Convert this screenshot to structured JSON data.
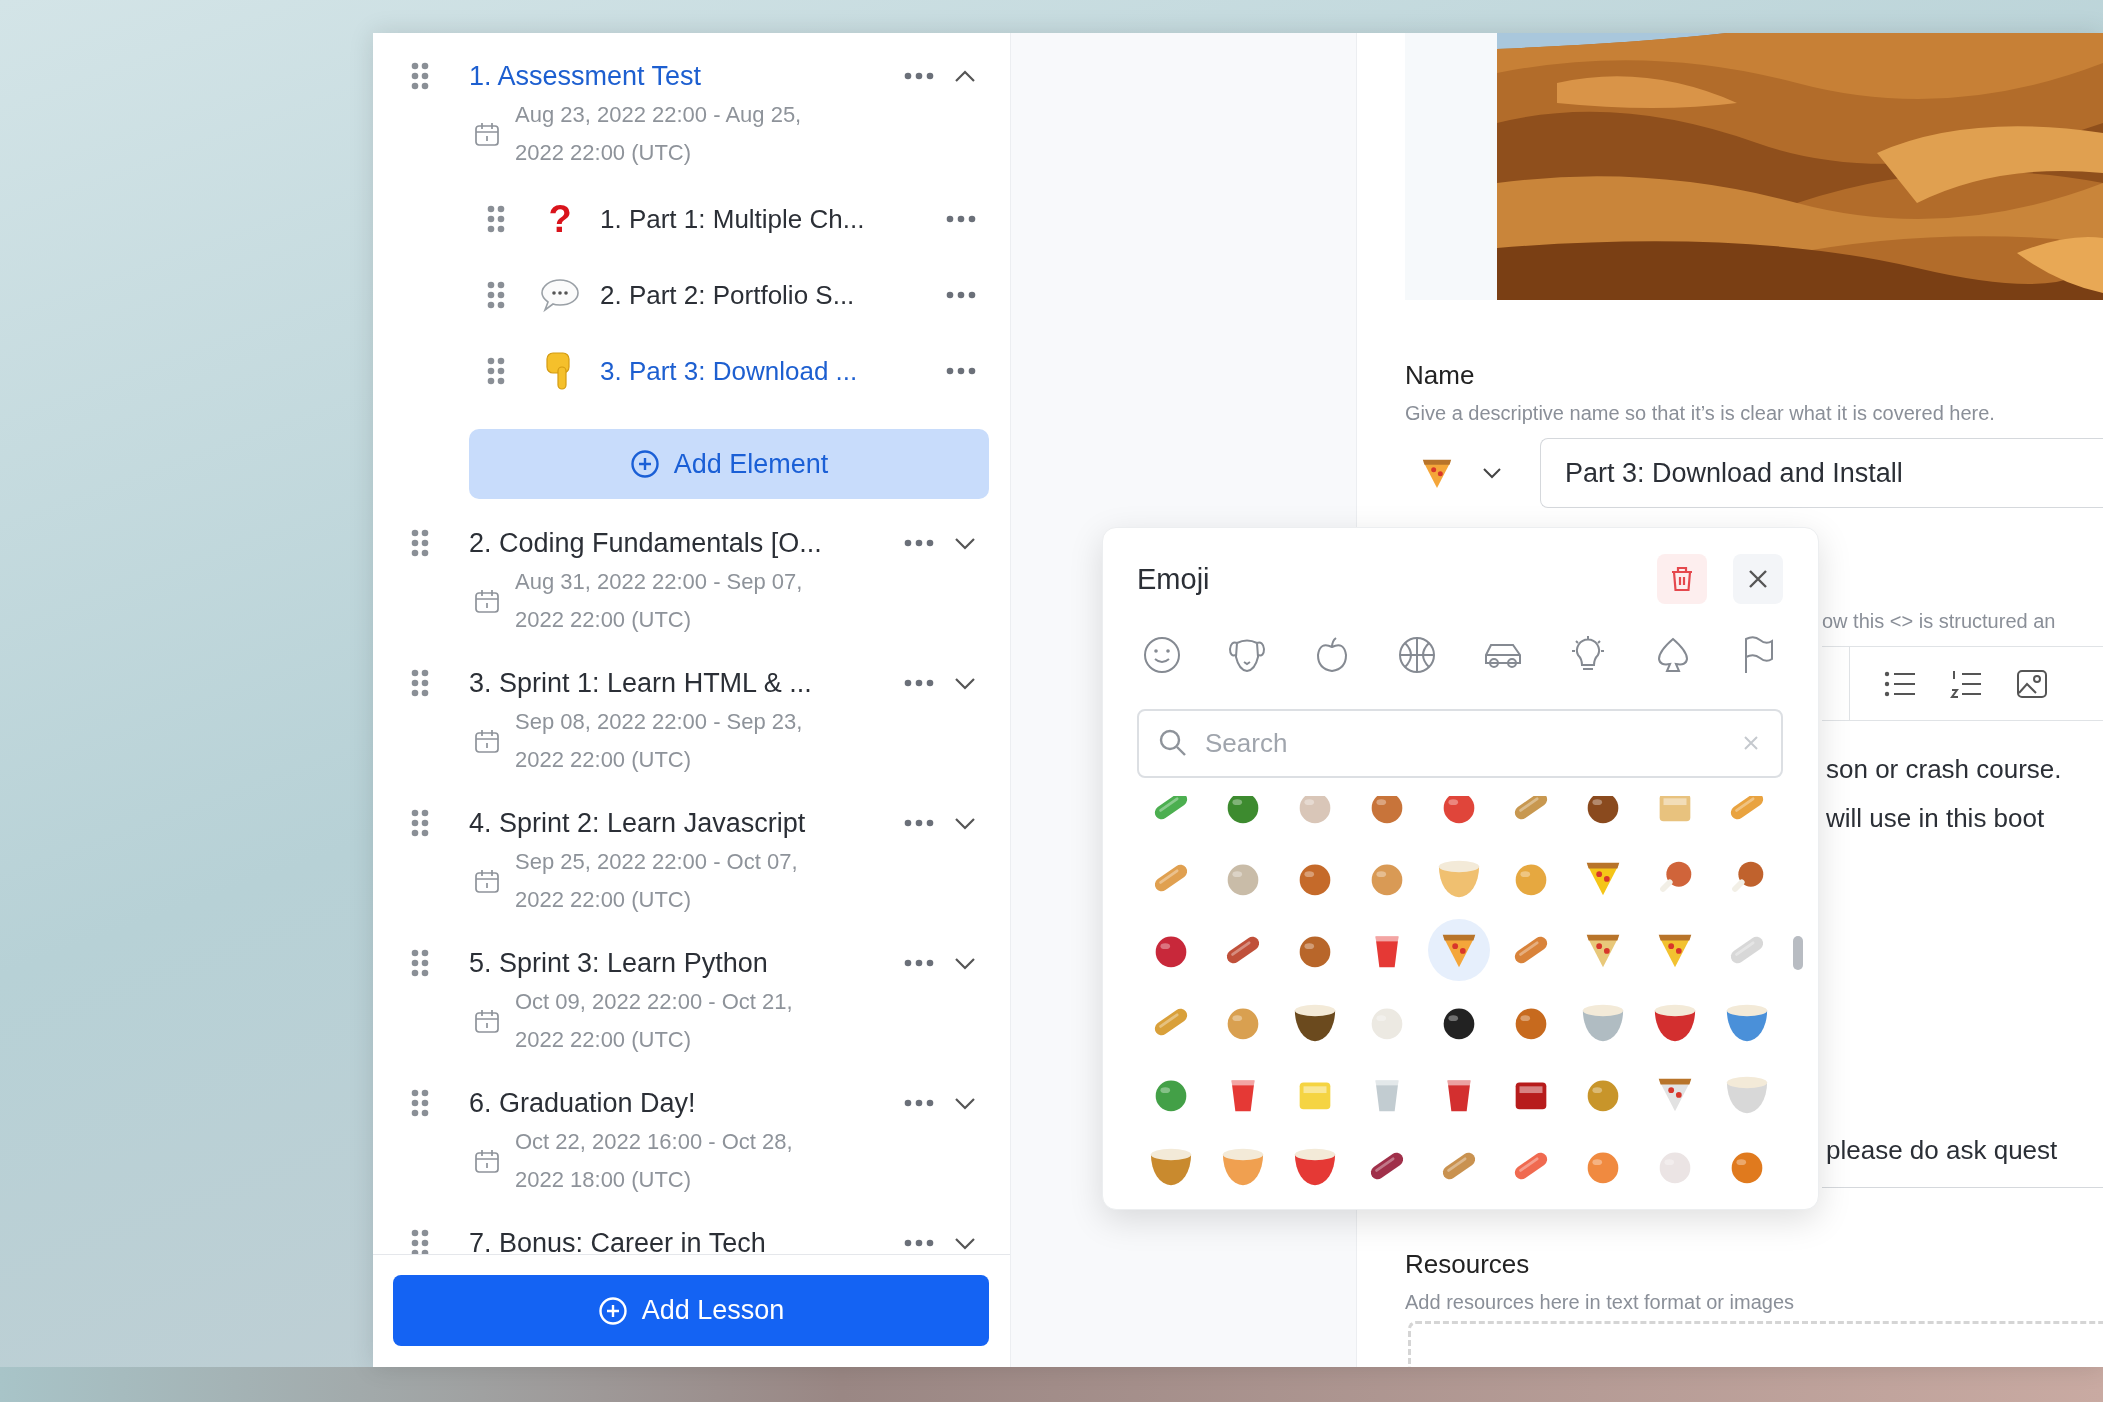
{
  "sidebar": {
    "lessons": [
      {
        "title": "1. Assessment Test",
        "selected": true,
        "expanded": true,
        "dates": "Aug 23, 2022 22:00 - Aug 25, 2022 22:00 (UTC)",
        "children": [
          {
            "kind": "glyph",
            "icon": "?",
            "title": "1. Part 1: Multiple Ch...",
            "selected": false
          },
          {
            "kind": "speech",
            "title": "2. Part 2: Portfolio S...",
            "selected": false
          },
          {
            "kind": "pointer",
            "title": "3. Part 3: Download ...",
            "selected": true
          }
        ],
        "add_button": "Add Element"
      },
      {
        "title": "2. Coding Fundamentals [O...",
        "selected": false,
        "expanded": false,
        "dates": "Aug 31, 2022 22:00 - Sep 07, 2022 22:00 (UTC)"
      },
      {
        "title": "3. Sprint 1: Learn HTML & ...",
        "selected": false,
        "expanded": false,
        "dates": "Sep 08, 2022 22:00 - Sep 23, 2022 22:00 (UTC)"
      },
      {
        "title": "4. Sprint 2: Learn Javascript",
        "selected": false,
        "expanded": false,
        "dates": "Sep 25, 2022 22:00 - Oct 07, 2022 22:00 (UTC)"
      },
      {
        "title": "5. Sprint 3: Learn Python",
        "selected": false,
        "expanded": false,
        "dates": "Oct 09, 2022 22:00 - Oct 21, 2022 22:00 (UTC)"
      },
      {
        "title": "6. Graduation Day!",
        "selected": false,
        "expanded": false,
        "dates": "Oct 22, 2022 16:00 - Oct 28, 2022 18:00 (UTC)"
      },
      {
        "title": "7. Bonus: Career in Tech",
        "selected": false,
        "expanded": false
      }
    ],
    "add_lesson": "Add Lesson"
  },
  "editor": {
    "name_label": "Name",
    "name_hint": "Give a descriptive name so that it’s is clear what it is covered here.",
    "name_value": "Part 3: Download and Install",
    "description_hint": "ow this <> is structured an",
    "content_lines": [
      "son or crash course.",
      "will use in this boot",
      "please do ask quest"
    ],
    "resources_label": "Resources",
    "resources_hint": "Add resources here in text format or images"
  },
  "emoji_picker": {
    "title": "Emoji",
    "search_placeholder": "Search",
    "items": [
      {
        "kind": "long",
        "color": "#4caf50",
        "selected": false
      },
      {
        "kind": "round",
        "color": "#3d8b2f",
        "selected": false
      },
      {
        "kind": "round",
        "color": "#d9c6b8",
        "selected": false
      },
      {
        "kind": "round",
        "color": "#c8743a",
        "selected": false
      },
      {
        "kind": "round",
        "color": "#e0453a",
        "selected": false
      },
      {
        "kind": "long",
        "color": "#c89850",
        "selected": false
      },
      {
        "kind": "round",
        "color": "#8a4a1e",
        "selected": false
      },
      {
        "kind": "box",
        "color": "#e8c27e",
        "selected": false
      },
      {
        "kind": "long",
        "color": "#e9a340",
        "selected": false
      },
      {
        "kind": "long",
        "color": "#e0a050",
        "selected": false
      },
      {
        "kind": "round",
        "color": "#c9bca8",
        "selected": false
      },
      {
        "kind": "round",
        "color": "#c56a2a",
        "selected": false
      },
      {
        "kind": "round",
        "color": "#d99a55",
        "selected": false
      },
      {
        "kind": "bowl",
        "color": "#f0c070",
        "selected": false
      },
      {
        "kind": "round",
        "color": "#e6a840",
        "selected": false
      },
      {
        "kind": "slice",
        "color": "#f5c518",
        "selected": false
      },
      {
        "kind": "drumstick",
        "color": "#d0643a",
        "selected": false
      },
      {
        "kind": "drumstick",
        "color": "#c0622d",
        "selected": false
      },
      {
        "kind": "round",
        "color": "#c8283a",
        "selected": false
      },
      {
        "kind": "long",
        "color": "#c0503a",
        "selected": false
      },
      {
        "kind": "round",
        "color": "#b8662a",
        "selected": false
      },
      {
        "kind": "cup",
        "color": "#e53935",
        "selected": false
      },
      {
        "kind": "slice",
        "color": "#f4a63a",
        "selected": true
      },
      {
        "kind": "long",
        "color": "#d9833a",
        "selected": false
      },
      {
        "kind": "slice",
        "color": "#e8c87a",
        "selected": false
      },
      {
        "kind": "slice",
        "color": "#f2c230",
        "selected": false
      },
      {
        "kind": "long",
        "color": "#d8d8d8",
        "selected": false
      },
      {
        "kind": "long",
        "color": "#d9a03a",
        "selected": false
      },
      {
        "kind": "round",
        "color": "#d9a050",
        "selected": false
      },
      {
        "kind": "bowl",
        "color": "#6b4a1e",
        "selected": false
      },
      {
        "kind": "round",
        "color": "#ece9e2",
        "selected": false
      },
      {
        "kind": "round",
        "color": "#222222",
        "selected": false
      },
      {
        "kind": "round",
        "color": "#c76a1e",
        "selected": false
      },
      {
        "kind": "bowl",
        "color": "#b0bcc2",
        "selected": false
      },
      {
        "kind": "bowl",
        "color": "#d32f2f",
        "selected": false
      },
      {
        "kind": "bowl",
        "color": "#4a90d9",
        "selected": false
      },
      {
        "kind": "round",
        "color": "#43a047",
        "selected": false
      },
      {
        "kind": "cup",
        "color": "#e53935",
        "selected": false
      },
      {
        "kind": "box",
        "color": "#f5d442",
        "selected": false
      },
      {
        "kind": "cup",
        "color": "#c2ccd1",
        "selected": false
      },
      {
        "kind": "cup",
        "color": "#d32f2f",
        "selected": false
      },
      {
        "kind": "box",
        "color": "#b71c1c",
        "selected": false
      },
      {
        "kind": "round",
        "color": "#c8952a",
        "selected": false
      },
      {
        "kind": "slice",
        "color": "#e2e2e2",
        "selected": false
      },
      {
        "kind": "bowl",
        "color": "#d8d8d8",
        "selected": false
      },
      {
        "kind": "bowl",
        "color": "#c98a2e",
        "selected": false
      },
      {
        "kind": "bowl",
        "color": "#f0a050",
        "selected": false
      },
      {
        "kind": "bowl",
        "color": "#e53935",
        "selected": false
      },
      {
        "kind": "long",
        "color": "#a0304a",
        "selected": false
      },
      {
        "kind": "long",
        "color": "#c99250",
        "selected": false
      },
      {
        "kind": "long",
        "color": "#f06a50",
        "selected": false
      },
      {
        "kind": "round",
        "color": "#f08a40",
        "selected": false
      },
      {
        "kind": "round",
        "color": "#ebe4e4",
        "selected": false
      },
      {
        "kind": "round",
        "color": "#e07a1e",
        "selected": false
      }
    ]
  }
}
